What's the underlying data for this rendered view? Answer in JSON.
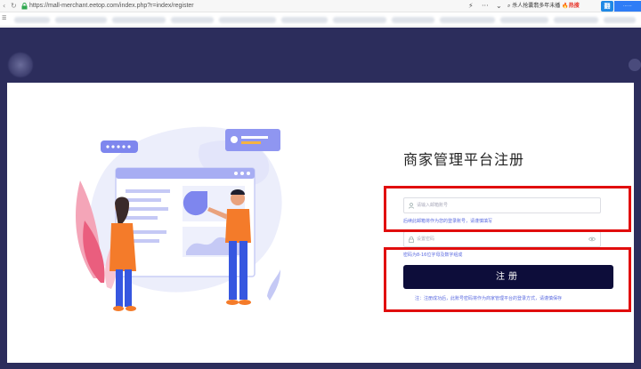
{
  "browser": {
    "url": "https://mall-merchant.eetop.com/index.php?r=index/register",
    "search_text": "杀人抢囊翡多年未播",
    "hot_label": "热搜",
    "ext_label": "翻"
  },
  "page": {
    "title": "商家管理平台注册",
    "email_placeholder": "请输入邮箱账号",
    "email_hint": "后续此邮箱将作为您的登录账号，请谨慎填写",
    "password_placeholder": "设置密码",
    "password_hint": "密码为8-16位字母及数字组成",
    "submit_label": "注册",
    "note": "注：注册成功后，此账号密码将作为商家管理平台的登录方式，请谨慎保存"
  },
  "colors": {
    "page_background": "#2c2d5c",
    "button": "#0d0d3a",
    "hint_text": "#5b6be0",
    "highlight_box": "#e10d0d"
  }
}
